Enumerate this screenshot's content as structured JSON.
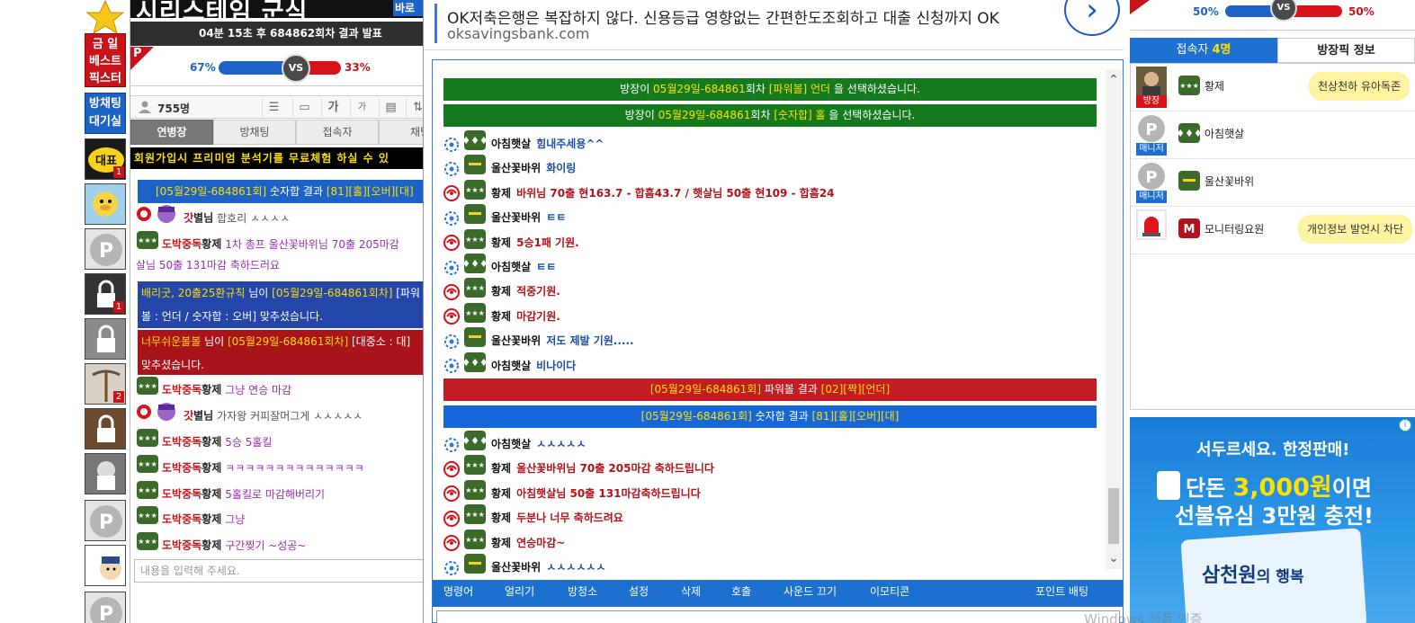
{
  "rail": {
    "red_label": [
      "금 일",
      "베스트",
      "픽스터"
    ],
    "blue_label": [
      "방채팅",
      "대기실"
    ],
    "thumb_counts": [
      "1",
      "",
      "",
      "1",
      "",
      "2",
      "",
      ""
    ]
  },
  "left": {
    "banner_text": "시리스테임 군식",
    "banner_badge": "바로",
    "timer": "04분 15초 후 684862회차 결과 발표",
    "vs": {
      "blue_pct": "67%",
      "red_pct": "33%",
      "blue_share": 0.67,
      "label": "VS",
      "p_label": "P"
    },
    "users_count": "755명",
    "tabs": [
      "연병장",
      "방채팅",
      "접속자",
      "채팅"
    ],
    "promo": "회원가입시 프리미엄 분석기를 무료체험 하실 수 있",
    "result_blue": {
      "pre": "[05월29일-684861회]",
      "mid": " 숫자합 결과 ",
      "vals": "[81][홀][오버][대]"
    },
    "messages": [
      {
        "n1": "갓",
        "n2": "별님",
        "text": "합호리 ㅅㅅㅅㅅ",
        "style": "txt2"
      },
      {
        "n1": "도박중독",
        "n2": "황제",
        "text": "1차 총프 울산꽃바위님 70출 205마감",
        "style": "txt"
      }
    ],
    "cont1": "살님 50출 131마감 축하드러요",
    "notice_blue": {
      "pre": "배리굿, 20출25환규칙",
      "mid": " 님이 ",
      "round": "[05월29일-684861회차]",
      "rest": " [파워",
      "line2": "볼 : 언더 / 숫자합 : 오버] 맞추셨습니다."
    },
    "notice_red": {
      "pre": "너무쉬운볼볼",
      "mid": " 님이 ",
      "round": "[05월29일-684861회차]",
      "rest": " [대중소 : 대]",
      "line2": "맞추셨습니다."
    },
    "messages2": [
      {
        "n1": "도박중독",
        "n2": "황제",
        "text": "그냥 연승 마감",
        "style": "txt"
      },
      {
        "n1": "갓",
        "n2": "별님",
        "text": "가자왕 커피잘머그게 ㅅㅅㅅㅅㅅ",
        "style": "txt2"
      },
      {
        "n1": "도박중독",
        "n2": "황제",
        "text": "5승 5홀킬",
        "style": "txt"
      },
      {
        "n1": "도박중독",
        "n2": "황제",
        "text": "ㅋㅋㅋㅋㅋㅋㅋㅋㅋㅋㅋㅋㅋㅋ",
        "style": "txt"
      },
      {
        "n1": "도박중독",
        "n2": "황제",
        "text": "5홀킬로 마감해버리기",
        "style": "txt"
      },
      {
        "n1": "도박중독",
        "n2": "황제",
        "text": "그냥",
        "style": "txt"
      },
      {
        "n1": "도박중독",
        "n2": "황제",
        "text": "구간찢기 ~성공~",
        "style": "txt"
      }
    ],
    "input_placeholder": "내용을 입력해 주세요."
  },
  "center": {
    "ad_title": "OK저축은행은 복잡하지 않다. 신용등급 영향없는 간편한도조회하고 대출 신청까지 OK",
    "ad_url": "oksavingsbank.com",
    "ad_arrow": "›",
    "sys1": {
      "a": "방장이 ",
      "round": "05월29일-684861",
      "b": "회차  ",
      "pick": "[파워볼] 언더",
      "c": " 을 선택하셨습니다."
    },
    "sys2": {
      "a": "방장이 ",
      "round": "05월29일-684861",
      "b": "회차  ",
      "pick": "[숫자합] 홀",
      "c": " 을 선택하셨습니다."
    },
    "msgs1": [
      {
        "nick": "아침햇살",
        "text": "힘내주세용^^",
        "color": "blue",
        "side": "blue"
      },
      {
        "nick": "울산꽃바위",
        "text": "화이링",
        "color": "blue",
        "side": "blue"
      },
      {
        "nick": "황제",
        "text": "바위님 70출 현163.7 - 합흠43.7 /  햇살님 50출 현109 - 합흠24",
        "color": "red",
        "side": "red"
      },
      {
        "nick": "울산꽃바위",
        "text": "ㅌㅌ",
        "color": "blue",
        "side": "blue"
      },
      {
        "nick": "황제",
        "text": "5승1패 기원.",
        "color": "red",
        "side": "red"
      },
      {
        "nick": "아침햇살",
        "text": "ㅌㅌ",
        "color": "blue",
        "side": "blue"
      },
      {
        "nick": "황제",
        "text": "적중기원.",
        "color": "red",
        "side": "red"
      },
      {
        "nick": "황제",
        "text": "마감기원.",
        "color": "red",
        "side": "red"
      },
      {
        "nick": "울산꽃바위",
        "text": "저도 제발 기원.....",
        "color": "blue",
        "side": "blue"
      },
      {
        "nick": "아침햇살",
        "text": "비나이다",
        "color": "blue",
        "side": "blue"
      }
    ],
    "sys_red": {
      "round": "[05월29일-684861회]",
      "mid": " 파워볼 결과 ",
      "vals": "[02][짝][언더]"
    },
    "sys_blue": {
      "round": "[05월29일-684861회]",
      "mid": " 숫자합 결과 ",
      "vals": "[81][홀][오버][대]"
    },
    "msgs2": [
      {
        "nick": "아침햇살",
        "text": "ㅅㅅㅅㅅㅅ",
        "color": "blue",
        "side": "blue"
      },
      {
        "nick": "황제",
        "text": "울산꽃바위님 70출 205마감 축하드립니다",
        "color": "red",
        "side": "red"
      },
      {
        "nick": "황제",
        "text": "아침햇살님 50출 131마감축하드립니다",
        "color": "red",
        "side": "red"
      },
      {
        "nick": "황제",
        "text": "두분나 너무 축하드려요",
        "color": "red",
        "side": "red"
      },
      {
        "nick": "황제",
        "text": "연승마감~",
        "color": "red",
        "side": "red"
      },
      {
        "nick": "울산꽃바위",
        "text": "ㅅㅅㅅㅅㅅㅅ",
        "color": "blue",
        "side": "blue"
      }
    ],
    "menu": [
      "명령어",
      "얼리기",
      "방청소",
      "설정",
      "삭제",
      "호출",
      "사운드 끄기",
      "이모티콘",
      "포인트 배팅"
    ]
  },
  "right": {
    "vs": {
      "blue_pct": "50%",
      "red_pct": "50%",
      "label": "VS"
    },
    "tab_users_label": "접속자 ",
    "tab_users_count": "4명",
    "tab_info_label": "방장픽 정보",
    "users": [
      {
        "name": "황제",
        "badge": "방장",
        "bubble": "천상천하 유아독존"
      },
      {
        "name": "아침햇살",
        "badge": "매니저",
        "bubble": ""
      },
      {
        "name": "울산꽃바위",
        "badge": "매니저",
        "bubble": ""
      },
      {
        "name": "모니터링요원",
        "badge": "",
        "bubble": "개인정보 발언시 차단"
      }
    ],
    "ad": {
      "l1a": "서두르세요. ",
      "l1b": "한정판매!",
      "l2a": "단돈 ",
      "l2b": "3,000원",
      "l2c": "이면",
      "l3": "선불유심 3만원 충전!",
      "l4a": "삼천원",
      "l4b": "의 행복",
      "info": "i"
    }
  },
  "watermark": "Windows 정품 인증",
  "colors": {
    "accent_blue": "#1d6fd0",
    "red": "#c7141a",
    "green": "#157a1d",
    "yellow": "#ffe000"
  }
}
